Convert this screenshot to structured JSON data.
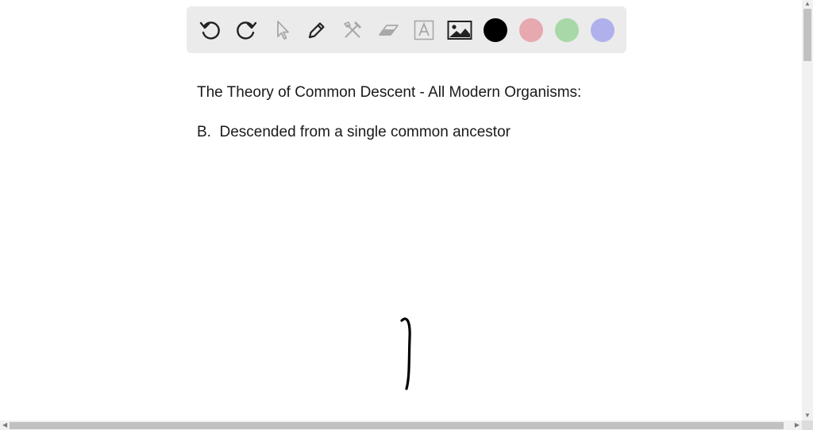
{
  "toolbar": {
    "tools": [
      {
        "icon": "undo-icon",
        "enabled": true
      },
      {
        "icon": "redo-icon",
        "enabled": true
      },
      {
        "icon": "pointer-icon",
        "enabled": false
      },
      {
        "icon": "pen-icon",
        "enabled": true
      },
      {
        "icon": "tools-icon",
        "enabled": false
      },
      {
        "icon": "eraser-icon",
        "enabled": false
      },
      {
        "icon": "text-icon",
        "enabled": false
      },
      {
        "icon": "image-icon",
        "enabled": true
      }
    ],
    "colors": [
      "#000000",
      "#e8a8b0",
      "#a8d8a8",
      "#b0b0ec"
    ],
    "selected_color": "#000000"
  },
  "canvas": {
    "heading": "The Theory of Common Descent - All Modern Organisms:",
    "answer": "B.  Descended from a single common ancestor"
  },
  "ink_color": "#000000"
}
